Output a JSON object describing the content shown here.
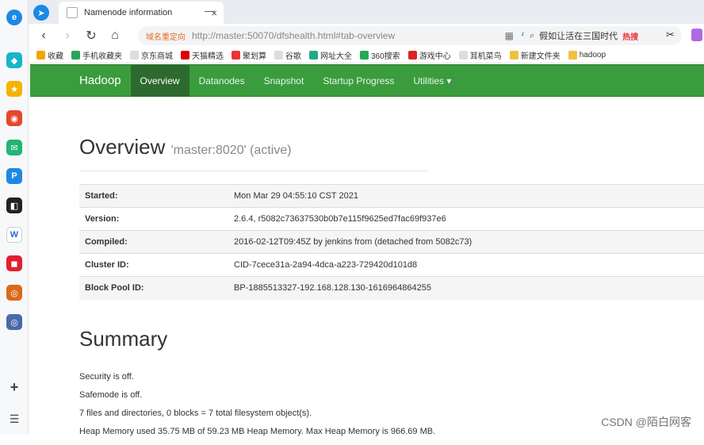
{
  "browser": {
    "tab_title": "Namenode information",
    "tab_close": "×",
    "new_tab": "—",
    "url_badge": "域名重定向",
    "url": "http://master:50070/dfshealth.html#tab-overview",
    "search_text": "假如让活在三国时代",
    "search_hot": "热搜"
  },
  "bookmarks": [
    {
      "label": "收藏",
      "color": "#f0a500"
    },
    {
      "label": "手机收藏夹",
      "color": "#2aa55a"
    },
    {
      "label": "京东商城",
      "color": "#ccc"
    },
    {
      "label": "天猫精选",
      "color": "#d00"
    },
    {
      "label": "聚划算",
      "color": "#e33"
    },
    {
      "label": "谷歌",
      "color": "#ccc"
    },
    {
      "label": "网址大全",
      "color": "#2a8"
    },
    {
      "label": "360搜索",
      "color": "#2a5"
    },
    {
      "label": "游戏中心",
      "color": "#d22"
    },
    {
      "label": "耳机菜鸟",
      "color": "#ccc"
    },
    {
      "label": "新建文件夹",
      "color": "#f0c040"
    },
    {
      "label": "hadoop",
      "color": "#f0c040"
    }
  ],
  "navbar": {
    "brand": "Hadoop",
    "items": [
      "Overview",
      "Datanodes",
      "Snapshot",
      "Startup Progress",
      "Utilities ▾"
    ]
  },
  "overview": {
    "title": "Overview",
    "subtitle": "'master:8020' (active)",
    "rows": [
      {
        "k": "Started:",
        "v": "Mon Mar 29 04:55:10 CST 2021"
      },
      {
        "k": "Version:",
        "v": "2.6.4, r5082c73637530b0b7e115f9625ed7fac69f937e6"
      },
      {
        "k": "Compiled:",
        "v": "2016-02-12T09:45Z by jenkins from (detached from 5082c73)"
      },
      {
        "k": "Cluster ID:",
        "v": "CID-7cece31a-2a94-4dca-a223-729420d101d8"
      },
      {
        "k": "Block Pool ID:",
        "v": "BP-1885513327-192.168.128.130-1616964864255"
      }
    ]
  },
  "summary": {
    "title": "Summary",
    "lines": [
      "Security is off.",
      "Safemode is off.",
      "7 files and directories, 0 blocks = 7 total filesystem object(s).",
      "Heap Memory used 35.75 MB of 59.23 MB Heap Memory. Max Heap Memory is 966.69 MB."
    ]
  },
  "watermark": "CSDN @陌白网客"
}
